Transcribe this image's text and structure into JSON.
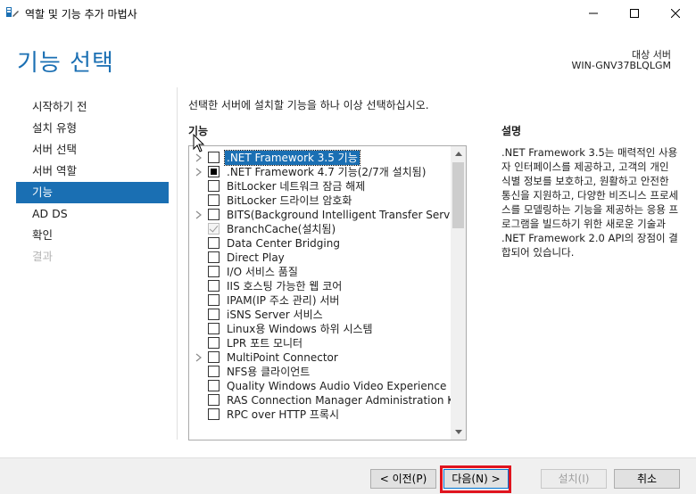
{
  "window": {
    "title": "역할 및 기능 추가 마법사",
    "icons": [
      "app-icon",
      "minimize-icon",
      "maximize-icon",
      "close-icon"
    ]
  },
  "header": {
    "title": "기능 선택",
    "target_label": "대상 서버",
    "target_name": "WIN-GNV37BLQLGM"
  },
  "sidebar": {
    "items": [
      {
        "label": "시작하기 전",
        "state": "normal"
      },
      {
        "label": "설치 유형",
        "state": "normal"
      },
      {
        "label": "서버 선택",
        "state": "normal"
      },
      {
        "label": "서버 역할",
        "state": "normal"
      },
      {
        "label": "기능",
        "state": "active"
      },
      {
        "label": "AD DS",
        "state": "normal"
      },
      {
        "label": "확인",
        "state": "normal"
      },
      {
        "label": "결과",
        "state": "disabled"
      }
    ]
  },
  "main": {
    "instruction": "선택한 서버에 설치할 기능을 하나 이상 선택하십시오.",
    "features_label": "기능",
    "features": [
      {
        "label": ".NET Framework 3.5 기능",
        "expandable": true,
        "check": "none",
        "selected": true
      },
      {
        "label": ".NET Framework 4.7 기능(2/7개 설치됨)",
        "expandable": true,
        "check": "partial",
        "selected": false
      },
      {
        "label": "BitLocker 네트워크 잠금 해제",
        "expandable": false,
        "check": "none",
        "selected": false
      },
      {
        "label": "BitLocker 드라이브 암호화",
        "expandable": false,
        "check": "none",
        "selected": false
      },
      {
        "label": "BITS(Background Intelligent Transfer Service)",
        "expandable": true,
        "check": "none",
        "selected": false
      },
      {
        "label": "BranchCache(설치됨)",
        "expandable": false,
        "check": "checked-disabled",
        "selected": false
      },
      {
        "label": "Data Center Bridging",
        "expandable": false,
        "check": "none",
        "selected": false
      },
      {
        "label": "Direct Play",
        "expandable": false,
        "check": "none",
        "selected": false
      },
      {
        "label": "I/O 서비스 품질",
        "expandable": false,
        "check": "none",
        "selected": false
      },
      {
        "label": "IIS 호스팅 가능한 웹 코어",
        "expandable": false,
        "check": "none",
        "selected": false
      },
      {
        "label": "IPAM(IP 주소 관리) 서버",
        "expandable": false,
        "check": "none",
        "selected": false
      },
      {
        "label": "iSNS Server 서비스",
        "expandable": false,
        "check": "none",
        "selected": false
      },
      {
        "label": "Linux용 Windows 하위 시스템",
        "expandable": false,
        "check": "none",
        "selected": false
      },
      {
        "label": "LPR 포트 모니터",
        "expandable": false,
        "check": "none",
        "selected": false
      },
      {
        "label": "MultiPoint Connector",
        "expandable": true,
        "check": "none",
        "selected": false
      },
      {
        "label": "NFS용 클라이언트",
        "expandable": false,
        "check": "none",
        "selected": false
      },
      {
        "label": "Quality Windows Audio Video Experience",
        "expandable": false,
        "check": "none",
        "selected": false
      },
      {
        "label": "RAS Connection Manager Administration Kit (CM",
        "expandable": false,
        "check": "none",
        "selected": false
      },
      {
        "label": "RPC over HTTP 프록시",
        "expandable": false,
        "check": "none",
        "selected": false
      }
    ],
    "description_label": "설명",
    "description": ".NET Framework 3.5는 매력적인 사용자 인터페이스를 제공하고, 고객의 개인 식별 정보를 보호하고, 원활하고 안전한 통신을 지원하고, 다양한 비즈니스 프로세스를 모델링하는 기능을 제공하는 응용 프로그램을 빌드하기 위한 새로운 기술과 .NET Framework 2.0 API의 장점이 결합되어 있습니다."
  },
  "footer": {
    "prev_label": "< 이전(P)",
    "next_label": "다음(N) >",
    "install_label": "설치(I)",
    "cancel_label": "취소"
  },
  "colors": {
    "accent": "#1a6fb3",
    "highlight": "#e0141e"
  }
}
